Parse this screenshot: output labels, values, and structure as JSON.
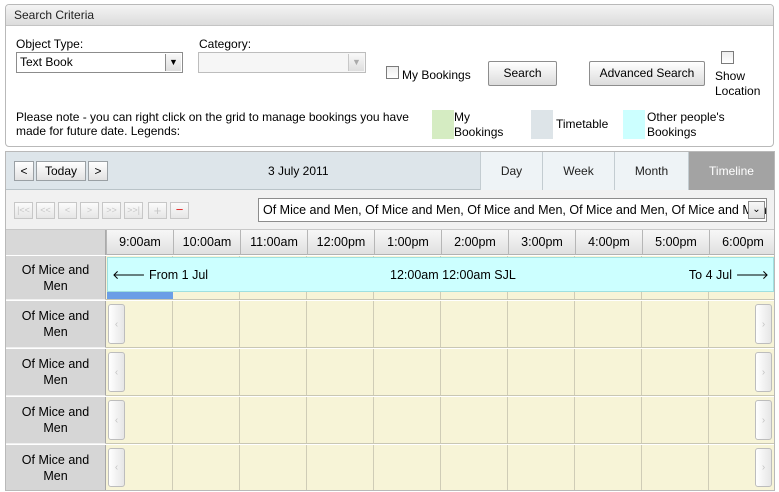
{
  "criteria": {
    "title": "Search Criteria",
    "object_type_label": "Object Type:",
    "object_type_value": "Text Book",
    "category_label": "Category:",
    "category_value": "",
    "my_bookings_label": "My Bookings",
    "search_label": "Search",
    "advanced_search_label": "Advanced Search",
    "show_location_label": "Show\nLocation",
    "note_line1": "Please note - you can right click on the grid to manage bookings you have",
    "note_line2": "made for future date. Legends:",
    "legends": [
      {
        "label": "My\nBookings",
        "color": "#d5ecc2"
      },
      {
        "label": "Timetable",
        "color": "#dde4e8"
      },
      {
        "label": "Other people's\nBookings",
        "color": "#ccffff"
      }
    ]
  },
  "calendar": {
    "prev_icon": "chevron-left-icon",
    "today_label": "Today",
    "next_icon": "chevron-right-icon",
    "date_label": "3 July 2011",
    "views": [
      "Day",
      "Week",
      "Month",
      "Timeline"
    ],
    "active_view": "Timeline",
    "toolbar_icons": [
      "first-icon",
      "fast-back-icon",
      "back-icon",
      "forward-icon",
      "fast-forward-icon",
      "last-icon",
      "add-icon",
      "remove-icon"
    ],
    "resource_select_value": "Of Mice and Men, Of Mice and Men, Of Mice and Men, Of Mice and Men, Of Mice and Men",
    "times": [
      "9:00am",
      "10:00am",
      "11:00am",
      "12:00pm",
      "1:00pm",
      "2:00pm",
      "3:00pm",
      "4:00pm",
      "5:00pm",
      "6:00pm"
    ],
    "rows": [
      "Of Mice and\nMen",
      "Of Mice and\nMen",
      "Of Mice and\nMen",
      "Of Mice and\nMen",
      "Of Mice and\nMen"
    ],
    "booking": {
      "from_label": "From 1 Jul",
      "center_label": "12:00am 12:00am SJL",
      "to_label": "To 4 Jul",
      "color": "#ccffff"
    }
  }
}
